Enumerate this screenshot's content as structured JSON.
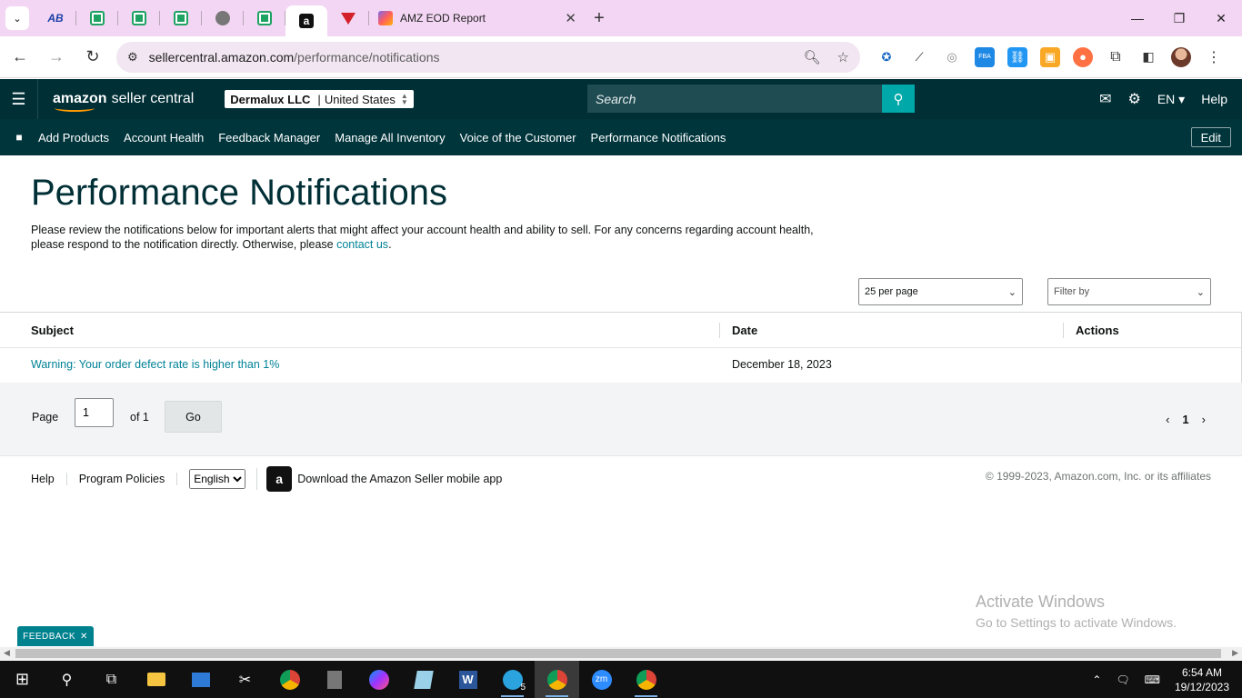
{
  "browser": {
    "tabs": [
      {
        "name": "tab-ab",
        "icon": "ab-icon"
      },
      {
        "name": "tab-sheet-1",
        "icon": "sheet-icon"
      },
      {
        "name": "tab-sheet-2",
        "icon": "sheet-icon"
      },
      {
        "name": "tab-sheet-3",
        "icon": "sheet-icon"
      },
      {
        "name": "tab-globe",
        "icon": "globe-icon"
      },
      {
        "name": "tab-sheet-4",
        "icon": "sheet-icon"
      },
      {
        "name": "tab-amazon",
        "icon": "amazon-icon"
      },
      {
        "name": "tab-red",
        "icon": "triangle-icon"
      }
    ],
    "active_tab_title": "AMZ EOD Report",
    "url_host": "sellercentral.amazon.com",
    "url_path": "/performance/notifications"
  },
  "header": {
    "logo_bold": "amazon",
    "logo_rest": "seller central",
    "account_name": "Dermalux LLC",
    "account_region": "United States",
    "search_placeholder": "Search",
    "language": "EN",
    "help": "Help"
  },
  "nav": {
    "links": [
      "Add Products",
      "Account Health",
      "Feedback Manager",
      "Manage All Inventory",
      "Voice of the Customer",
      "Performance Notifications"
    ],
    "edit": "Edit"
  },
  "main": {
    "title": "Performance Notifications",
    "intro_text": "Please review the notifications below for important alerts that might affect your account health and ability to sell. For any concerns regarding account health, please respond to the notification directly. Otherwise, please ",
    "intro_link": "contact us",
    "intro_end": ".",
    "per_page": "25 per page",
    "filter_by": "Filter by"
  },
  "table": {
    "headers": {
      "subject": "Subject",
      "date": "Date",
      "actions": "Actions"
    },
    "rows": [
      {
        "subject": "Warning: Your order defect rate is higher than 1%",
        "date": "December 18, 2023",
        "actions": ""
      }
    ]
  },
  "pager": {
    "page_label": "Page",
    "page_value": "1",
    "of_label": "of 1",
    "go": "Go",
    "current": "1"
  },
  "footer": {
    "help": "Help",
    "program_policies": "Program Policies",
    "language_selected": "English",
    "app_text": "Download the Amazon Seller mobile app",
    "copyright": "© 1999-2023, Amazon.com, Inc. or its affiliates"
  },
  "overlay": {
    "activate_title": "Activate Windows",
    "activate_sub": "Go to Settings to activate Windows.",
    "feedback": "FEEDBACK"
  },
  "taskbar": {
    "time": "6:54 AM",
    "date": "19/12/2023",
    "telegram_badge": "5"
  }
}
